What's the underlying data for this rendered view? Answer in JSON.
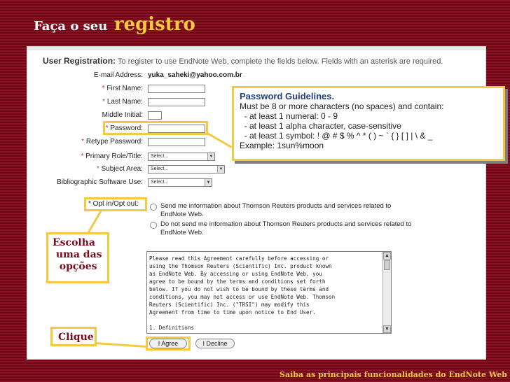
{
  "slide": {
    "title_part1": "Faça o seu",
    "title_part2": "registro",
    "footer": "Saiba as principais funcionalidades do EndNote Web"
  },
  "form": {
    "header_title": "User Registration:",
    "header_text": "To register to use EndNote Web, complete the fields below.  Fields with an asterisk are required.",
    "email_label": "E-mail Address:",
    "email_value": "yuka_saheki@yahoo.com.br",
    "first_name_label": "First Name:",
    "last_name_label": "Last Name:",
    "middle_initial_label": "Middle Initial:",
    "password_label": "Password:",
    "retype_password_label": "Retype Password:",
    "primary_role_label": "Primary Role/Title:",
    "subject_area_label": "Subject Area:",
    "bib_software_label": "Bibliographic Software Use:",
    "select_placeholder": "Select...",
    "asterisk": "*",
    "opt_label": "* Opt in/Opt out:",
    "opt_in_text": "Send me information about Thomson Reuters products and services related to EndNote Web.",
    "opt_out_text": "Do not send me information about Thomson Reuters products and services related to EndNote Web.",
    "agreement_text": "Please read this Agreement carefully before accessing or\nusing the Thomson Reuters (Scientific) Inc. product known\nas EndNote Web. By accessing or using EndNote Web, you\nagree to be bound by the terms and conditions set forth\nbelow. If you do not wish to be bound by these terms and\nconditions, you may not access or use EndNote Web. Thomson\nReuters (Scientific) Inc. (\"TRSI\") may modify this\nAgreement from time to time upon notice to End User.\n\n1. Definitions",
    "agree_button": "I Agree",
    "decline_button": "I Decline"
  },
  "password_guidelines": {
    "title": "Password Guidelines.",
    "lines": [
      "Must be 8 or more characters (no spaces) and contain:",
      "  - at least 1 numeral: 0 - 9",
      "  - at least 1 alpha character, case-sensitive",
      "  - at least 1 symbol: ! @ # $ % ^ * ( ) ~ ` { } [ ] | \\ & _",
      "Example: 1sun%moon"
    ]
  },
  "callouts": {
    "choose": "Escolha\n uma das\n  opções",
    "click": "Clique"
  },
  "colors": {
    "background": "#7a0d1c",
    "highlight": "#f5c842",
    "guidelines_title": "#23407a"
  }
}
